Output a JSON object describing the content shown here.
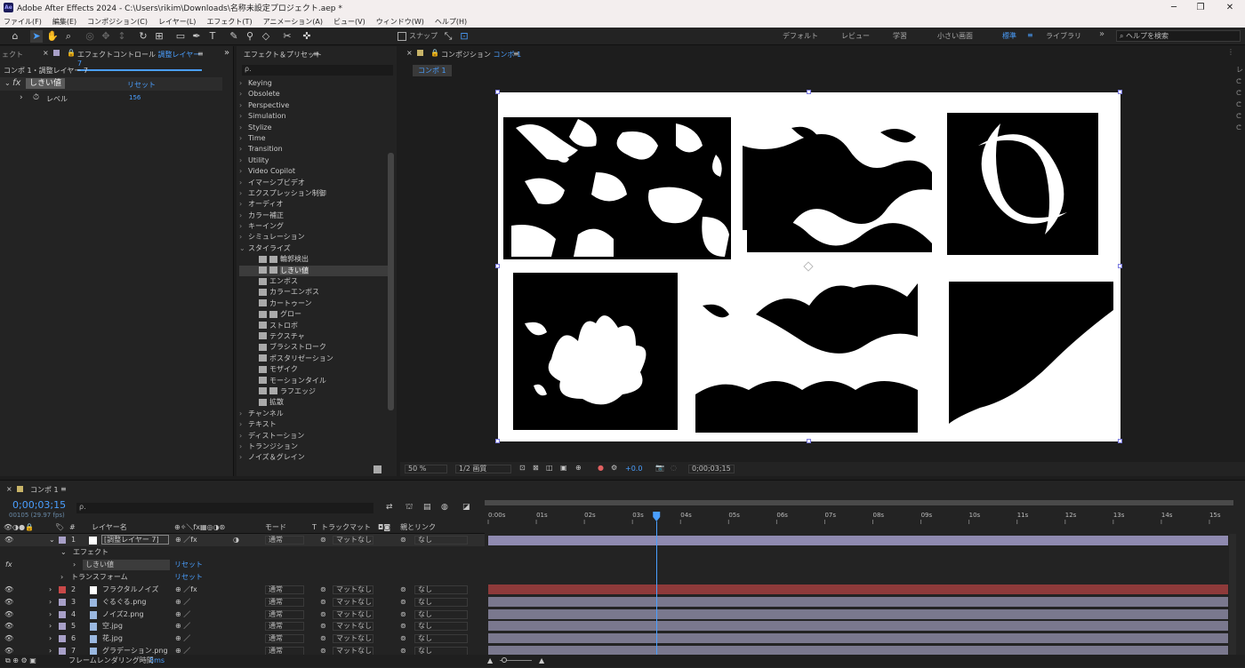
{
  "title_bar": {
    "app_icon": "Ae",
    "title": "Adobe After Effects 2024 - C:\\Users\\rikim\\Downloads\\名称未設定プロジェクト.aep *",
    "minimize": "─",
    "maximize": "❐",
    "close": "✕"
  },
  "menu": [
    "ファイル(F)",
    "編集(E)",
    "コンポジション(C)",
    "レイヤー(L)",
    "エフェクト(T)",
    "アニメーション(A)",
    "ビュー(V)",
    "ウィンドウ(W)",
    "ヘルプ(H)"
  ],
  "toolbar": {
    "snap_label": "スナップ",
    "workspaces": [
      "デフォルト",
      "レビュー",
      "学習",
      "小さい画面",
      "標準",
      "ライブラリ"
    ],
    "active_workspace": "標準",
    "more": "»",
    "search_placeholder": "ヘルプを検索"
  },
  "effect_controls": {
    "left_tab": "ェクト",
    "tab_label": "エフェクトコントロール",
    "tab_layer": "調整レイヤー 7",
    "header": "コンポ 1・調整レイヤー 7",
    "effect_name": "しきい値",
    "reset": "リセット",
    "param_name": "レベル",
    "param_value": "156"
  },
  "effects_presets": {
    "tab": "エフェクト＆プリセット",
    "search_placeholder": "ρ.",
    "categories": [
      "Keying",
      "Obsolete",
      "Perspective",
      "Simulation",
      "Stylize",
      "Time",
      "Transition",
      "Utility",
      "Video Copilot",
      "イマーシブビデオ",
      "エクスプレッション制御",
      "オーディオ",
      "カラー補正",
      "キーイング",
      "シミュレーション"
    ],
    "open_category": "スタイライズ",
    "stylize_items": [
      {
        "label": "輪郭検出",
        "badge": true
      },
      {
        "label": "しきい値",
        "badge": true,
        "selected": true
      },
      {
        "label": "エンボス",
        "badge": false
      },
      {
        "label": "カラーエンボス",
        "badge": false
      },
      {
        "label": "カートゥーン",
        "badge": false
      },
      {
        "label": "グロー",
        "badge": true
      },
      {
        "label": "ストロボ",
        "badge": false
      },
      {
        "label": "テクスチャ",
        "badge": false
      },
      {
        "label": "ブラシストローク",
        "badge": false
      },
      {
        "label": "ポスタリゼーション",
        "badge": false
      },
      {
        "label": "モザイク",
        "badge": false
      },
      {
        "label": "モーションタイル",
        "badge": false
      },
      {
        "label": "ラフエッジ",
        "badge": true
      },
      {
        "label": "拡散",
        "badge": false
      }
    ],
    "after_categories": [
      "チャンネル",
      "テキスト",
      "ディストーション",
      "トランジション",
      "ノイズ＆グレイン"
    ]
  },
  "composition": {
    "tab_prefix": "コンポジション",
    "tab_name": "コンポ 1",
    "subtab": "コンポ 1",
    "zoom": "50 %",
    "resolution": "1/2 画質",
    "exposure": "+0.0",
    "timecode": "0;00;03;15"
  },
  "timeline": {
    "tab": "コンポ 1",
    "timecode": "0;00;03;15",
    "frame_info": "00105 (29.97 fps)",
    "search_placeholder": "ρ.",
    "col_layer_name": "レイヤー名",
    "col_mode": "モード",
    "col_t": "T",
    "col_trackmatte": "トラックマット",
    "col_parent": "親とリンク",
    "ruler": [
      "0:00s",
      "01s",
      "02s",
      "03s",
      "04s",
      "05s",
      "06s",
      "07s",
      "08s",
      "09s",
      "10s",
      "11s",
      "12s",
      "13s",
      "14s",
      "15s"
    ],
    "playhead_seconds": 3.5,
    "duration_seconds": 15.5,
    "effect_group": "エフェクト",
    "effect_name": "しきい値",
    "effect_reset": "リセット",
    "transform": "トランスフォーム",
    "transform_reset": "リセット",
    "layers": [
      {
        "num": "1",
        "name": "[調整レイヤー 7]",
        "color": "#a8a0c8",
        "mode": "通常",
        "matte": "マットなし",
        "parent": "なし",
        "bar": "#8f8ab0"
      },
      {
        "num": "2",
        "name": "フラクタルノイズ",
        "color": "#c84848",
        "mode": "通常",
        "matte": "マットなし",
        "parent": "なし",
        "bar": "#8e3a3a"
      },
      {
        "num": "3",
        "name": "ぐるぐる.png",
        "color": "#a8a0c8",
        "mode": "通常",
        "matte": "マットなし",
        "parent": "なし",
        "bar": "#7a788e"
      },
      {
        "num": "4",
        "name": "ノイズ2.png",
        "color": "#a8a0c8",
        "mode": "通常",
        "matte": "マットなし",
        "parent": "なし",
        "bar": "#7a788e"
      },
      {
        "num": "5",
        "name": "空.jpg",
        "color": "#a8a0c8",
        "mode": "通常",
        "matte": "マットなし",
        "parent": "なし",
        "bar": "#7a788e"
      },
      {
        "num": "6",
        "name": "花.jpg",
        "color": "#a8a0c8",
        "mode": "通常",
        "matte": "マットなし",
        "parent": "なし",
        "bar": "#7a788e"
      },
      {
        "num": "7",
        "name": "グラデーション.png",
        "color": "#a8a0c8",
        "mode": "通常",
        "matte": "マットなし",
        "parent": "なし",
        "bar": "#7a788e"
      }
    ],
    "render_label": "フレームレンダリング時間",
    "render_value": "5ms"
  }
}
